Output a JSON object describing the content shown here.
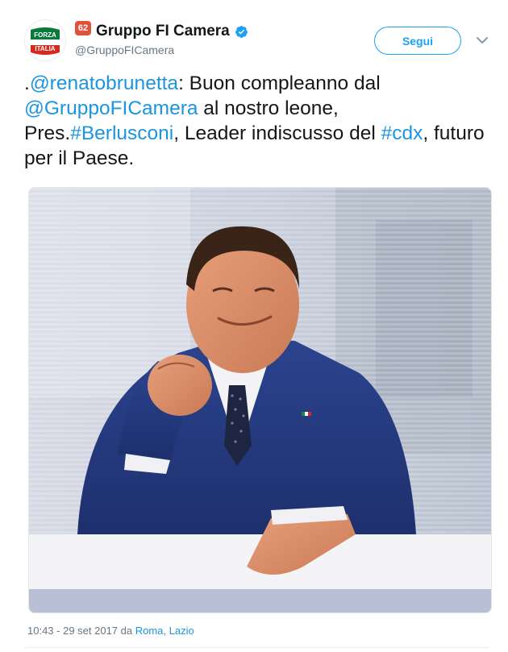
{
  "account": {
    "display_name": "Gruppo FI Camera",
    "handle": "@GruppoFICamera",
    "grade_badge": "62",
    "avatar_logo_text": "FORZA ITALIA",
    "verified": true
  },
  "follow_button": {
    "label": "Segui"
  },
  "tweet": {
    "prefix": ".",
    "mention_1": "@renatobrunetta",
    "text_1": ": Buon compleanno dal ",
    "mention_2": "@GruppoFICamera",
    "text_2": " al nostro leone, Pres.",
    "hashtag_1": "#Berlusconi",
    "text_3": ", Leader indiscusso del ",
    "hashtag_2": "#cdx",
    "text_4": ", futuro per il Paese."
  },
  "meta": {
    "time": "10:43 - 29 set 2017",
    "via": " da ",
    "place": "Roma",
    "separator": ", ",
    "region": "Lazio"
  },
  "colors": {
    "link": "#1b95e0",
    "follow": "#1da1f2",
    "verified": "#1da1f2",
    "badge": "#e0523a",
    "suit": "#23387d"
  },
  "icons": [
    "verified-badge-icon",
    "chevron-down-icon"
  ]
}
